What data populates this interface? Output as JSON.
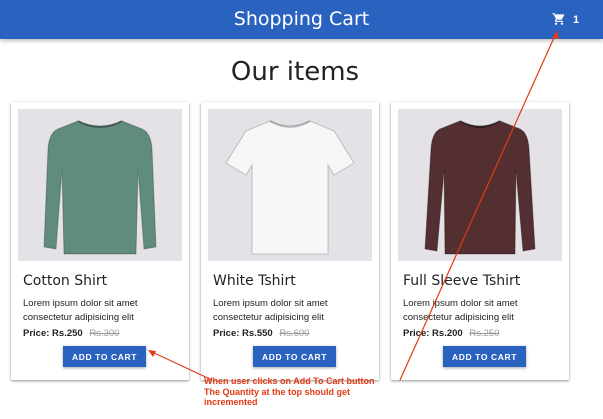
{
  "appbar": {
    "title": "Shopping Cart",
    "cart_count": "1"
  },
  "heading": "Our items",
  "items": [
    {
      "title": "Cotton Shirt",
      "description": "Lorem ipsum dolor sit amet consectetur adipisicing elit",
      "price_label": "Price:",
      "price": "Rs.250",
      "old_price": "Rs.300",
      "button": "ADD TO CART",
      "image_icon": "long-sleeve-shirt-icon",
      "shirt_color": "#5f8c7c"
    },
    {
      "title": "White Tshirt",
      "description": "Lorem ipsum dolor sit amet consectetur adipisicing elit",
      "price_label": "Price:",
      "price": "Rs.550",
      "old_price": "Rs.600",
      "button": "ADD TO CART",
      "image_icon": "tshirt-icon",
      "shirt_color": "#f7f7f7"
    },
    {
      "title": "Full Sleeve Tshirt",
      "description": "Lorem ipsum dolor sit amet consectetur adipisicing elit",
      "price_label": "Price:",
      "price": "Rs.200",
      "old_price": "Rs.250",
      "button": "ADD TO CART",
      "image_icon": "long-sleeve-shirt-icon",
      "shirt_color": "#532f31"
    }
  ],
  "annotation": {
    "lines": [
      "When user clicks on Add To Cart button",
      "The Quantity at the top should get",
      "incremented"
    ],
    "color": "#e23a14"
  },
  "colors": {
    "primary": "#2a62c0",
    "image_background": "#e4e2e6"
  }
}
